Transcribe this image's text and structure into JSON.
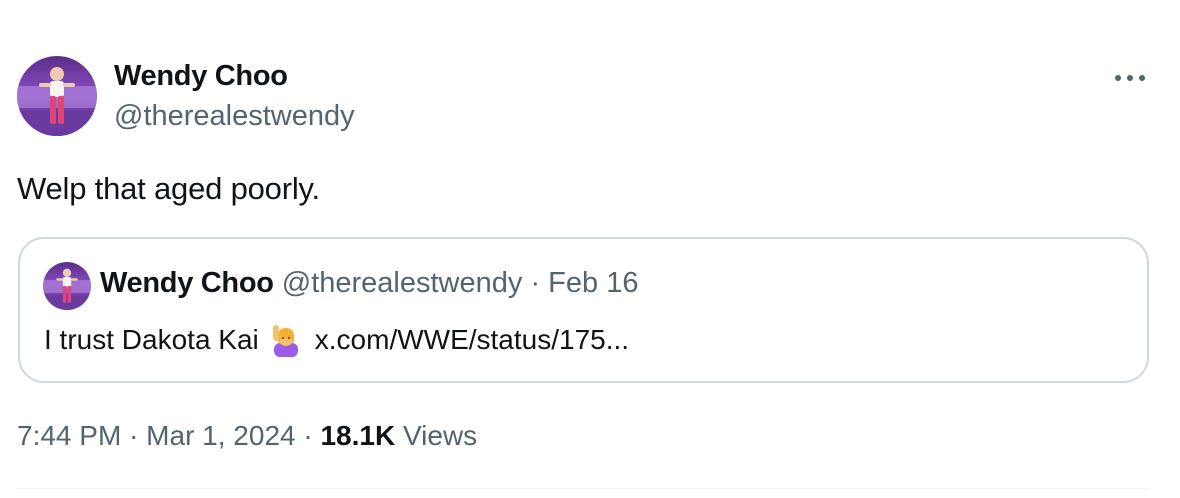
{
  "tweet": {
    "author_name": "Wendy Choo",
    "author_handle": "@therealestwendy",
    "text": "Welp that aged poorly.",
    "time": "7:44 PM",
    "date": "Mar 1, 2024",
    "views_count": "18.1K",
    "views_label": "Views",
    "separator": "·",
    "more_icon": "more-horizontal-icon"
  },
  "quote": {
    "author_name": "Wendy Choo",
    "author_handle": "@therealestwendy",
    "date": "Feb 16",
    "separator": "·",
    "text": "I trust Dakota Kai",
    "emoji": "woman-raising-hand-emoji",
    "link": "x.com/WWE/status/175..."
  },
  "colors": {
    "text_primary": "#0f1419",
    "text_secondary": "#536471",
    "border": "#cfd9de"
  }
}
